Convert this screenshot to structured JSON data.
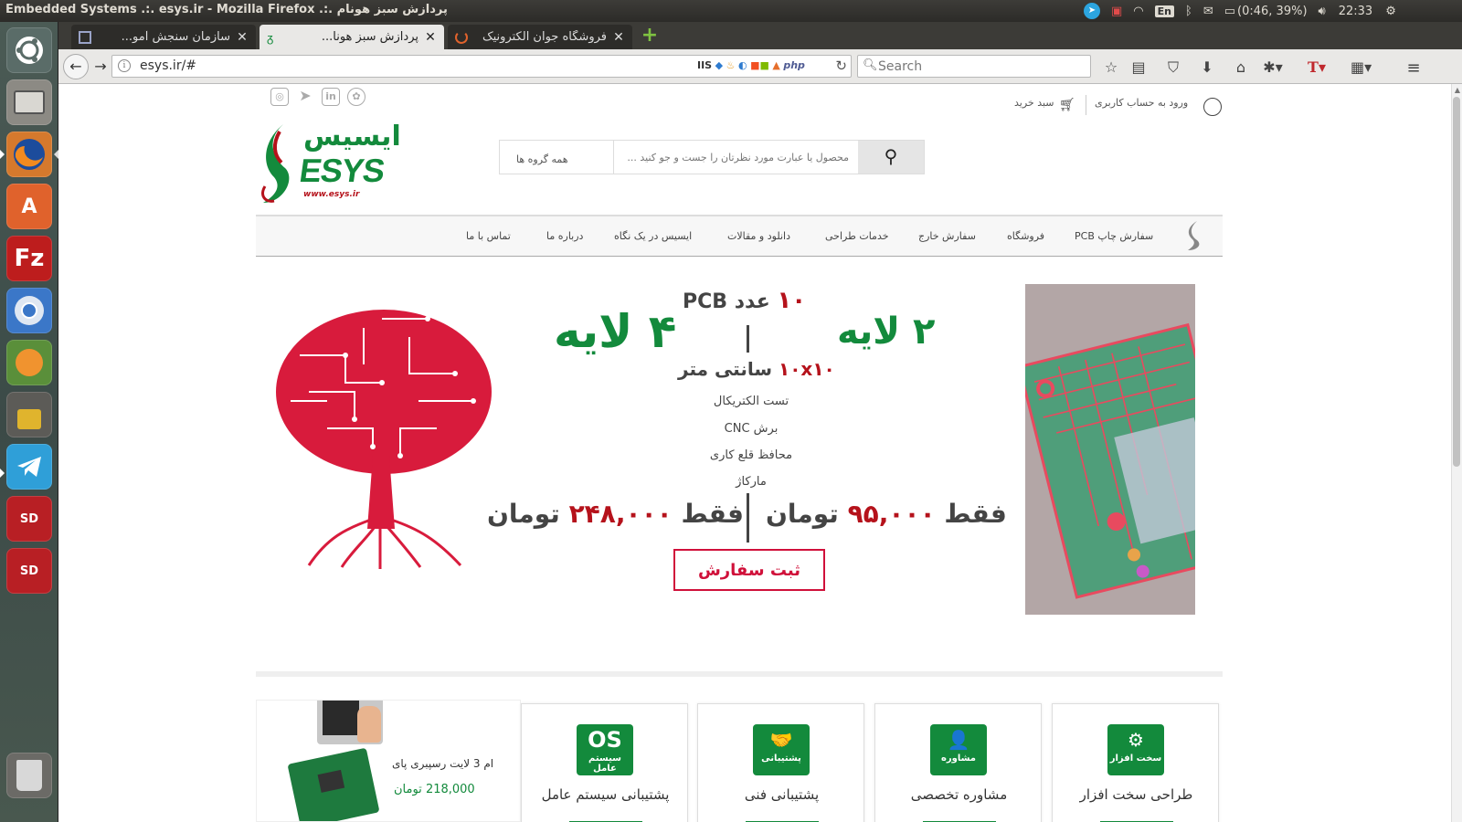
{
  "top_panel": {
    "window_title": "Embedded Systems .:. esys.ir - Mozilla Firefox .:. پردازش سبز هونام",
    "battery": "(0:46, 39%)",
    "clock": "22:33",
    "lang": "En"
  },
  "launcher": {
    "items": [
      "Ubuntu Dash",
      "Files",
      "Firefox",
      "Ubuntu Software",
      "FileZilla",
      "Chromium",
      "Eclipse",
      "Password Manager",
      "Telegram",
      "SD Card",
      "SD Card"
    ]
  },
  "tabs": [
    {
      "title": "سازمان سنجش آمو...",
      "active": false
    },
    {
      "title": "پردازش سبز هونا...",
      "active": true
    },
    {
      "title": "فروشگاه جوان الکترونیک",
      "active": false
    }
  ],
  "navbar": {
    "url": "esys.ir/#",
    "search_placeholder": "Search"
  },
  "header": {
    "login_text": "ورود به حساب کاربری",
    "cart_text": "سبد خرید",
    "search_placeholder": "محصول یا عبارت مورد نظرتان را جست و جو کنید ...",
    "search_group": "همه گروه ها",
    "logo_fa": "ایسیس",
    "logo_en": "ESYS",
    "logo_url": "www.esys.ir"
  },
  "nav_items": [
    "سفارش چاپ PCB",
    "فروشگاه",
    "سفارش خارج",
    "خدمات طراحی",
    "دانلود و مقالات",
    "ایسیس در یک نگاه",
    "درباره ما",
    "تماس با ما"
  ],
  "banner": {
    "qty_num": "۱۰",
    "qty_text": "عدد PCB",
    "layer2": "۲ لایه",
    "layer4": "۴ لایه",
    "size_num": "۱۰x۱۰",
    "size_text": "سانتی متر",
    "features": [
      "تست الکتریکال",
      "برش CNC",
      "محافظ قلع کاری",
      "مارکاژ"
    ],
    "price1_prefix": "فقط",
    "price1_num": "۹۵,۰۰۰",
    "price1_unit": "تومان",
    "price2_prefix": "فقط",
    "price2_num": "۲۴۸,۰۰۰",
    "price2_unit": "تومان",
    "order_button": "ثبت سفارش"
  },
  "services": [
    {
      "title": "طراحی سخت افزار",
      "icon_caption": "سخت افزار",
      "icon_glyph": "⚙"
    },
    {
      "title": "مشاوره تخصصی",
      "icon_caption": "مشاوره",
      "icon_glyph": "👤"
    },
    {
      "title": "پشتیبانی فنی",
      "icon_caption": "پشتیبانی",
      "icon_glyph": "🤝"
    },
    {
      "title": "پشتیبانی سیستم عامل",
      "icon_caption": "سیستم عامل",
      "icon_glyph": "OS"
    }
  ],
  "products": [
    {
      "name": "ام 3 لایت رسپبری پای",
      "price": "218,000 تومان"
    }
  ],
  "colors": {
    "brand_green": "#138a3c",
    "brand_red": "#b5121b",
    "button_red": "#d0103a"
  }
}
